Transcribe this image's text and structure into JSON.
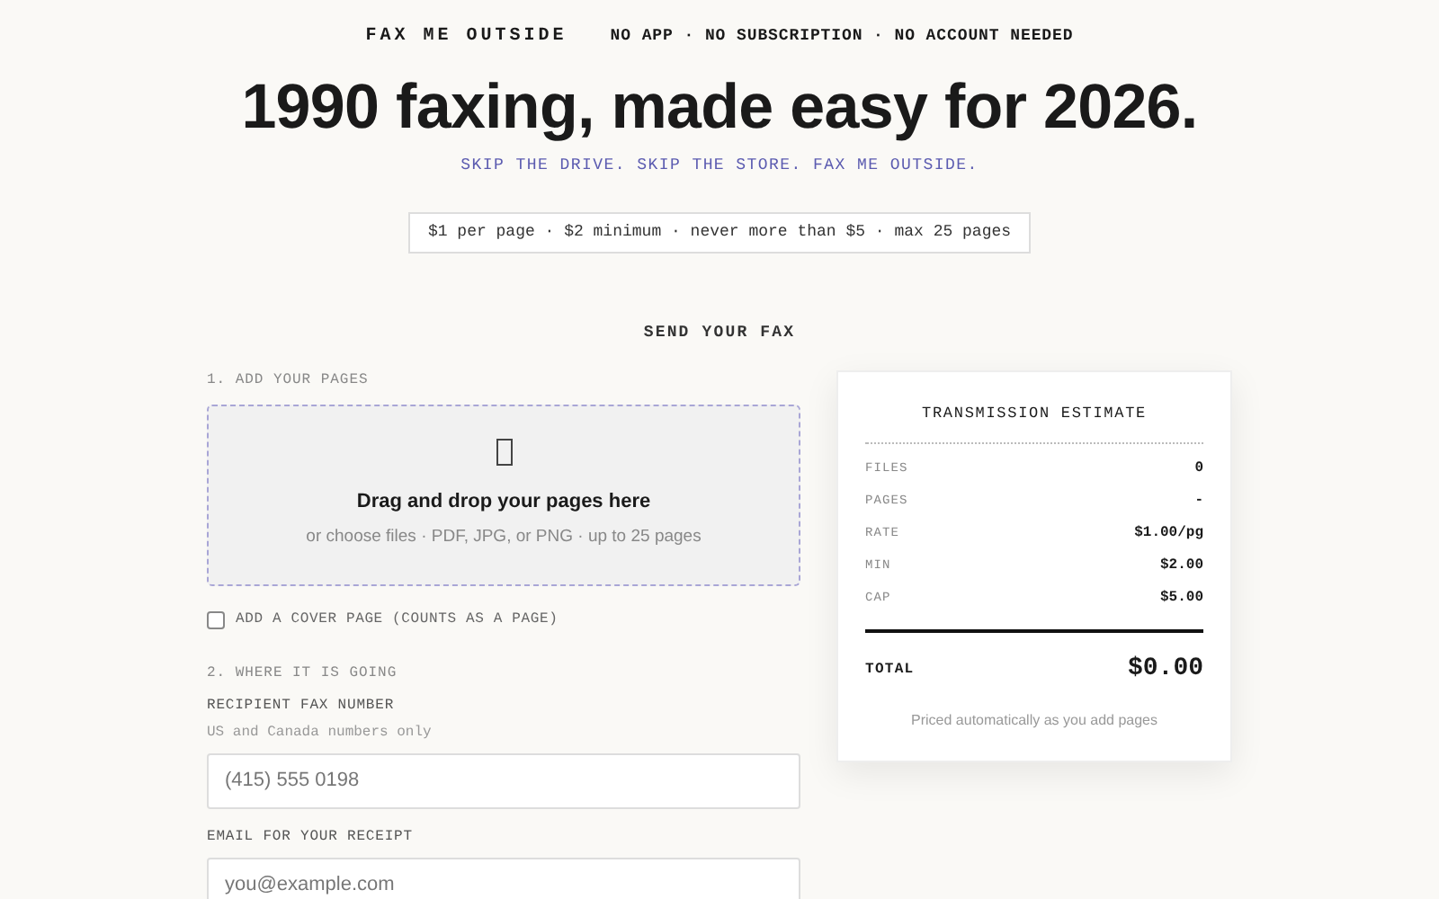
{
  "header": {
    "brand": "FAX ME OUTSIDE",
    "tagline": "NO APP · NO SUBSCRIPTION · NO ACCOUNT NEEDED"
  },
  "hero": {
    "title": "1990 faxing, made easy for 2026.",
    "subtitle": "SKIP THE DRIVE. SKIP THE STORE. FAX ME OUTSIDE.",
    "pricing": "$1 per page · $2 minimum · never more than $5 · max 25 pages"
  },
  "form": {
    "heading": "SEND YOUR FAX",
    "step1": {
      "label": "1. ADD YOUR PAGES",
      "drop_title": "Drag and drop your pages here",
      "drop_hint": "or choose files · PDF, JPG, or PNG · up to 25 pages"
    },
    "cover": {
      "label": "ADD A COVER PAGE (COUNTS AS A PAGE)",
      "checked": false
    },
    "step2": {
      "label": "2. WHERE IT IS GOING",
      "fields": [
        {
          "label": "RECIPIENT FAX NUMBER",
          "hint": "US and Canada numbers only",
          "placeholder": "(415) 555 0198"
        },
        {
          "label": "EMAIL FOR YOUR RECEIPT",
          "placeholder": "you@example.com"
        }
      ]
    }
  },
  "estimate": {
    "title": "TRANSMISSION ESTIMATE",
    "rows": [
      {
        "label": "FILES",
        "value": "0"
      },
      {
        "label": "PAGES",
        "value": "-"
      },
      {
        "label": "RATE",
        "value": "$1.00/pg"
      },
      {
        "label": "MIN",
        "value": "$2.00"
      },
      {
        "label": "CAP",
        "value": "$5.00"
      }
    ],
    "total_label": "TOTAL",
    "total": "$0.00",
    "note": "Priced automatically as you add pages"
  }
}
